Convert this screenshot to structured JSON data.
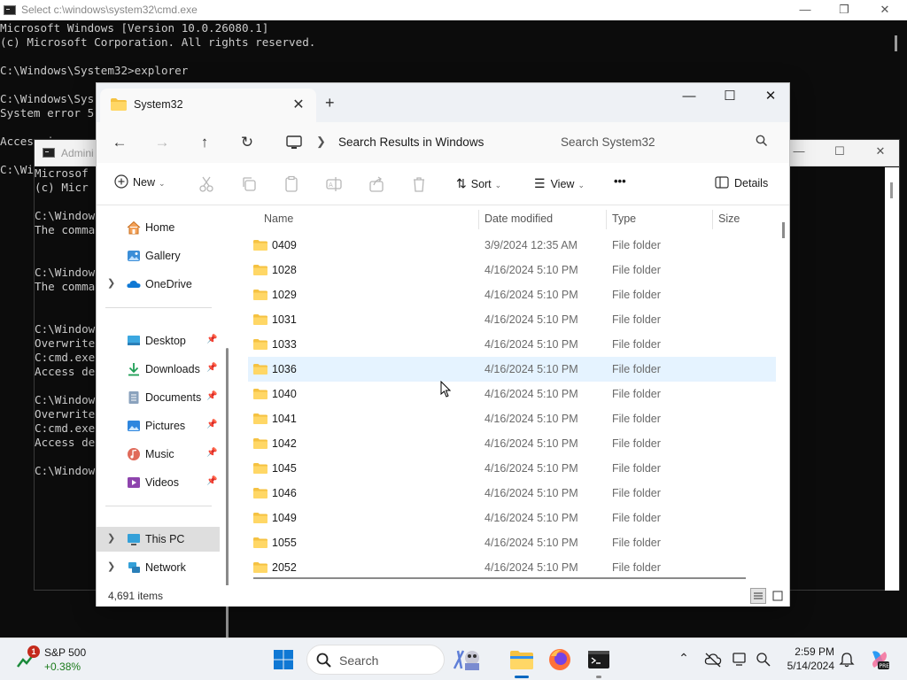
{
  "cmd": {
    "title": "Select c:\\windows\\system32\\cmd.exe",
    "lines": [
      "Microsoft Windows [Version 10.0.26080.1]",
      "(c) Microsoft Corporation. All rights reserved.",
      "",
      "C:\\Windows\\System32>explorer",
      "",
      "C:\\Windows\\Sys",
      "System error 5",
      "",
      "Access i",
      "",
      "C:\\Wi"
    ]
  },
  "admin_cmd": {
    "title": "Admini",
    "lines": [
      "Microsof",
      "(c) Micr",
      "",
      "C:\\Window",
      "The comma",
      "",
      "",
      "C:\\Window",
      "The comma",
      "",
      "",
      "C:\\Window",
      "Overwrite",
      "C:cmd.exe",
      "Access de",
      "",
      "C:\\Window",
      "Overwrite",
      "C:cmd.exe",
      "Access de",
      "",
      "C:\\Window"
    ]
  },
  "explorer": {
    "tab_title": "System32",
    "new_tab": "+",
    "breadcrumb": "Search Results in Windows",
    "search_placeholder": "Search System32",
    "commands": {
      "new": "New",
      "sort": "Sort",
      "view": "View",
      "more": "•••",
      "details": "Details"
    },
    "nav": {
      "home": "Home",
      "gallery": "Gallery",
      "onedrive": "OneDrive",
      "desktop": "Desktop",
      "downloads": "Downloads",
      "documents": "Documents",
      "pictures": "Pictures",
      "music": "Music",
      "videos": "Videos",
      "thispc": "This PC",
      "network": "Network"
    },
    "columns": {
      "name": "Name",
      "date": "Date modified",
      "type": "Type",
      "size": "Size"
    },
    "rows": [
      {
        "name": "0409",
        "date": "3/9/2024 12:35 AM",
        "type": "File folder"
      },
      {
        "name": "1028",
        "date": "4/16/2024 5:10 PM",
        "type": "File folder"
      },
      {
        "name": "1029",
        "date": "4/16/2024 5:10 PM",
        "type": "File folder"
      },
      {
        "name": "1031",
        "date": "4/16/2024 5:10 PM",
        "type": "File folder"
      },
      {
        "name": "1033",
        "date": "4/16/2024 5:10 PM",
        "type": "File folder"
      },
      {
        "name": "1036",
        "date": "4/16/2024 5:10 PM",
        "type": "File folder"
      },
      {
        "name": "1040",
        "date": "4/16/2024 5:10 PM",
        "type": "File folder"
      },
      {
        "name": "1041",
        "date": "4/16/2024 5:10 PM",
        "type": "File folder"
      },
      {
        "name": "1042",
        "date": "4/16/2024 5:10 PM",
        "type": "File folder"
      },
      {
        "name": "1045",
        "date": "4/16/2024 5:10 PM",
        "type": "File folder"
      },
      {
        "name": "1046",
        "date": "4/16/2024 5:10 PM",
        "type": "File folder"
      },
      {
        "name": "1049",
        "date": "4/16/2024 5:10 PM",
        "type": "File folder"
      },
      {
        "name": "1055",
        "date": "4/16/2024 5:10 PM",
        "type": "File folder"
      },
      {
        "name": "2052",
        "date": "4/16/2024 5:10 PM",
        "type": "File folder"
      }
    ],
    "status": "4,691 items"
  },
  "taskbar": {
    "widget_name": "S&P 500",
    "widget_change": "+0.38%",
    "widget_badge": "1",
    "search_label": "Search",
    "time": "2:59 PM",
    "date": "5/14/2024"
  },
  "colors": {
    "accent": "#0067c0",
    "folder": "#f5c242",
    "hover_row": "#e5f3ff",
    "cmd_bg": "#0c0c0c"
  }
}
